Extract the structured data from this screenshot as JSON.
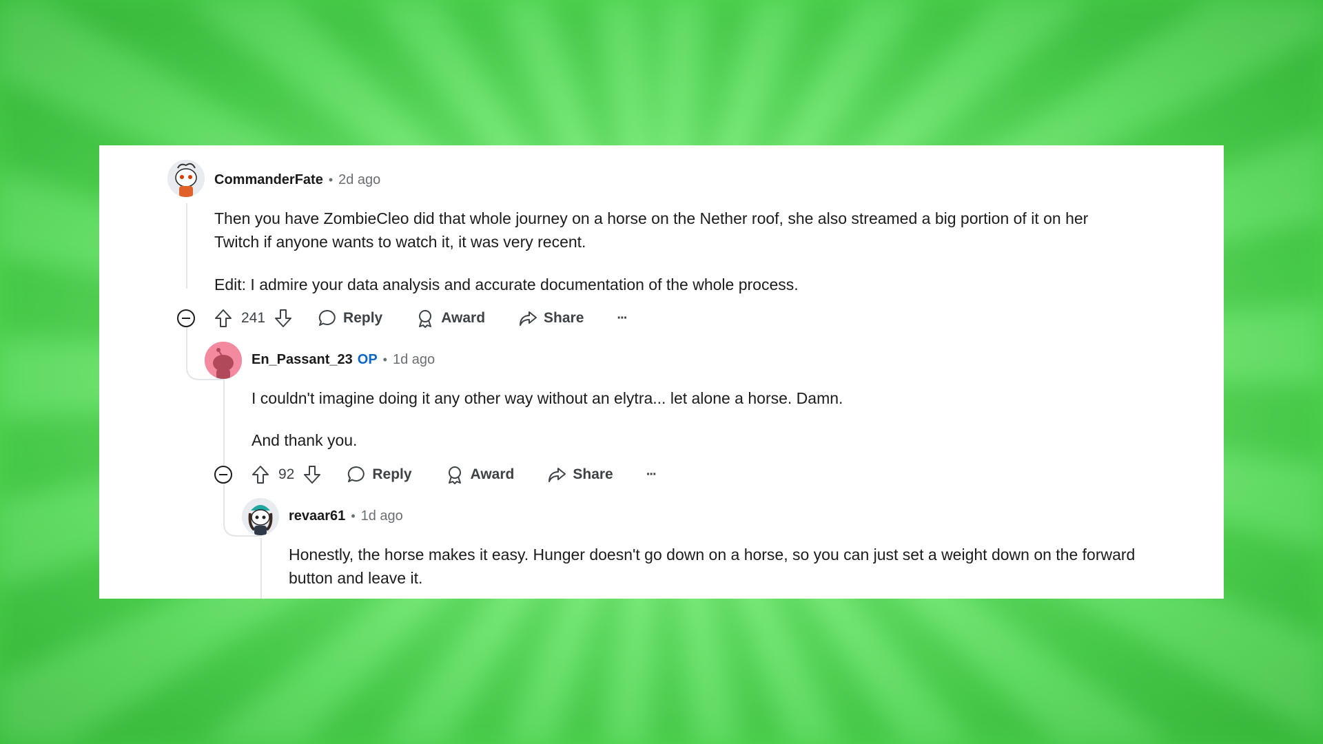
{
  "comments": [
    {
      "author": "CommanderFate",
      "time": "2d ago",
      "paragraphs": [
        "Then you have ZombieCleo did that whole journey on a horse on the Nether roof, she also streamed a big portion of it on her Twitch if anyone wants to watch it, it was very recent.",
        "Edit: I admire your data analysis and accurate documentation of the whole process."
      ],
      "votes": "241"
    },
    {
      "author": "En_Passant_23",
      "badge": "OP",
      "time": "1d ago",
      "paragraphs": [
        "I couldn't imagine doing it any other way without an elytra... let alone a horse. Damn.",
        "And thank you."
      ],
      "votes": "92"
    },
    {
      "author": "revaar61",
      "time": "1d ago",
      "paragraphs": [
        "Honestly, the horse makes it easy. Hunger doesn't go down on a horse, so you can just set a weight down on the forward button and leave it."
      ]
    }
  ],
  "actions": {
    "reply": "Reply",
    "award": "Award",
    "share": "Share",
    "more": "···"
  },
  "separator": "•",
  "colors": {
    "background": "#74ef74",
    "op_badge": "#0a66c8",
    "text": "#1c1c1c",
    "muted": "#6a6f73"
  }
}
